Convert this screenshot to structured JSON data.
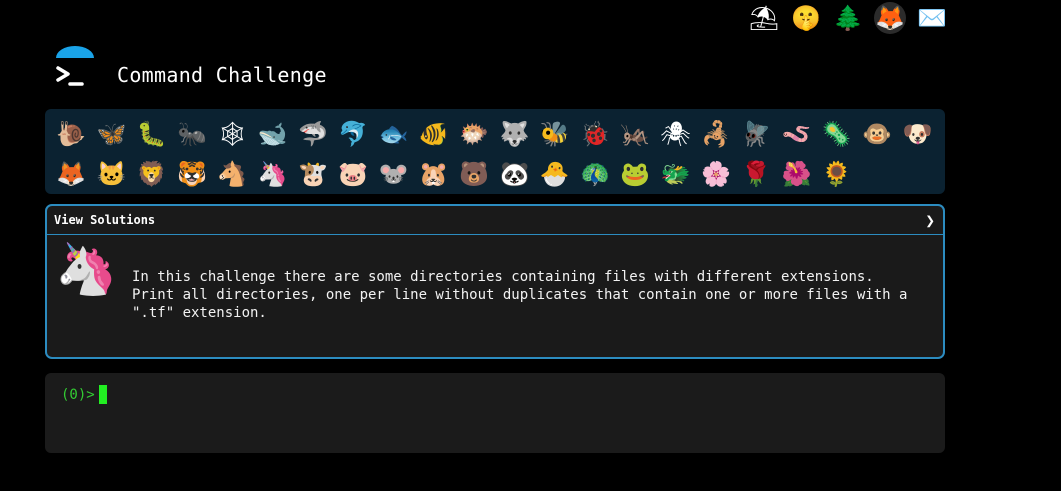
{
  "header": {
    "title": "Command Challenge",
    "logo_icon": "terminal-umbrella-icon",
    "top_icons": [
      {
        "name": "terminal-icon",
        "glyph": "⛱"
      },
      {
        "name": "shushing-face-icon",
        "glyph": "🤫"
      },
      {
        "name": "tree-icon",
        "glyph": "🌲"
      },
      {
        "name": "gitlab-icon",
        "glyph": "🦊"
      },
      {
        "name": "mail-icon",
        "glyph": "✉️"
      }
    ]
  },
  "challenges": [
    {
      "name": "snail",
      "glyph": "🐌"
    },
    {
      "name": "butterfly",
      "glyph": "🦋"
    },
    {
      "name": "caterpillar",
      "glyph": "🐛"
    },
    {
      "name": "ant",
      "glyph": "🐜"
    },
    {
      "name": "spider-web",
      "glyph": "🕸"
    },
    {
      "name": "whale",
      "glyph": "🐋"
    },
    {
      "name": "shark",
      "glyph": "🦈"
    },
    {
      "name": "dolphin",
      "glyph": "🐬"
    },
    {
      "name": "fish",
      "glyph": "🐟"
    },
    {
      "name": "tropical-fish",
      "glyph": "🐠"
    },
    {
      "name": "blowfish",
      "glyph": "🐡"
    },
    {
      "name": "wolf",
      "glyph": "🐺"
    },
    {
      "name": "bee",
      "glyph": "🐝"
    },
    {
      "name": "ladybug",
      "glyph": "🐞"
    },
    {
      "name": "cricket",
      "glyph": "🦗"
    },
    {
      "name": "spider",
      "glyph": "🕷"
    },
    {
      "name": "scorpion",
      "glyph": "🦂"
    },
    {
      "name": "fly",
      "glyph": "🪰"
    },
    {
      "name": "worm",
      "glyph": "🪱"
    },
    {
      "name": "microbe",
      "glyph": "🦠"
    },
    {
      "name": "monkey",
      "glyph": "🐵"
    },
    {
      "name": "dog",
      "glyph": "🐶"
    },
    {
      "name": "fox",
      "glyph": "🦊"
    },
    {
      "name": "cat",
      "glyph": "🐱"
    },
    {
      "name": "lion",
      "glyph": "🦁"
    },
    {
      "name": "tiger",
      "glyph": "🐯"
    },
    {
      "name": "horse",
      "glyph": "🐴"
    },
    {
      "name": "unicorn",
      "glyph": "🦄",
      "current": true
    },
    {
      "name": "cow",
      "glyph": "🐮"
    },
    {
      "name": "pig",
      "glyph": "🐷"
    },
    {
      "name": "mouse",
      "glyph": "🐭"
    },
    {
      "name": "hamster",
      "glyph": "🐹"
    },
    {
      "name": "bear",
      "glyph": "🐻"
    },
    {
      "name": "panda",
      "glyph": "🐼"
    },
    {
      "name": "hatching-chick",
      "glyph": "🐣"
    },
    {
      "name": "peacock",
      "glyph": "🦚"
    },
    {
      "name": "frog",
      "glyph": "🐸"
    },
    {
      "name": "dragon",
      "glyph": "🐲"
    },
    {
      "name": "cherry-blossom",
      "glyph": "🌸"
    },
    {
      "name": "rose",
      "glyph": "🌹"
    },
    {
      "name": "hibiscus",
      "glyph": "🌺"
    },
    {
      "name": "sunflower",
      "glyph": "🌻"
    }
  ],
  "panel": {
    "header_label": "View Solutions",
    "chevron": "❯",
    "avatar_glyph": "🦄",
    "description": "In this challenge there are some directories containing files with different extensions.\nPrint all directories, one per line without duplicates that contain one or more files with a\n\".tf\" extension."
  },
  "terminal": {
    "prompt": "(0)>",
    "input_value": ""
  },
  "colors": {
    "background": "#000000",
    "challenge_bar": "#0b2231",
    "panel_border": "#2c8cc0",
    "prompt_green": "#33cc33",
    "logo_blue": "#1aa3e8"
  }
}
